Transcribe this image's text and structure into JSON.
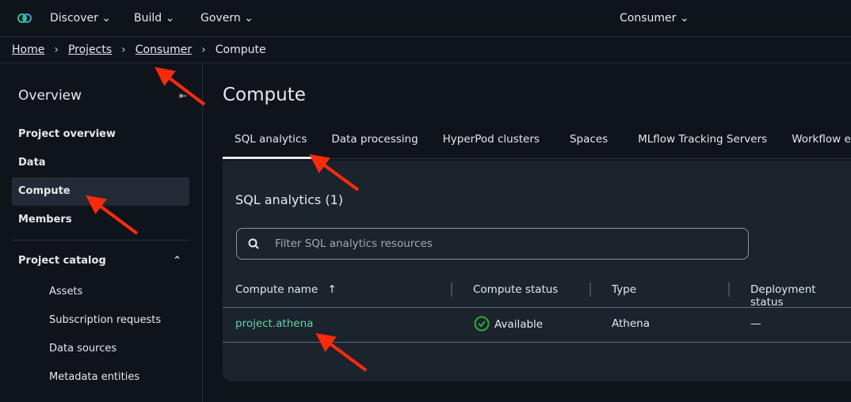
{
  "topnav": {
    "items": [
      "Discover",
      "Build",
      "Govern"
    ],
    "project": "Consumer"
  },
  "breadcrumb": {
    "items": [
      "Home",
      "Projects",
      "Consumer"
    ],
    "current": "Compute"
  },
  "sidebar": {
    "title": "Overview",
    "items": [
      "Project overview",
      "Data",
      "Compute",
      "Members"
    ],
    "active": "Compute",
    "catalog": "Project catalog",
    "catalog_items": [
      "Assets",
      "Subscription requests",
      "Data sources",
      "Metadata entities"
    ]
  },
  "main": {
    "title": "Compute",
    "tabs": [
      "SQL analytics",
      "Data processing",
      "HyperPod clusters",
      "Spaces",
      "MLflow Tracking Servers",
      "Workflow e"
    ],
    "active_tab": "SQL analytics",
    "panel_title": "SQL analytics (1)",
    "filter_placeholder": "Filter SQL analytics resources",
    "columns": [
      "Compute name",
      "Compute status",
      "Type",
      "Deployment status"
    ],
    "rows": [
      {
        "name": "project.athena",
        "status": "Available",
        "type": "Athena",
        "deployment": "—"
      }
    ]
  },
  "colors": {
    "link": "#5fd4a8",
    "available": "#29ad32",
    "annotation": "#ff2a0a"
  }
}
